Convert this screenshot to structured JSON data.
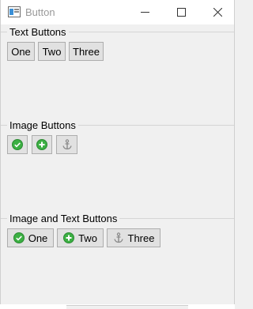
{
  "window": {
    "title": "Button"
  },
  "groups": {
    "text": {
      "label": "Text Buttons",
      "buttons": [
        "One",
        "Two",
        "Three"
      ]
    },
    "image": {
      "label": "Image Buttons",
      "icons": [
        "check-icon",
        "plus-icon",
        "anchor-icon"
      ]
    },
    "image_text": {
      "label": "Image and Text Buttons",
      "buttons": [
        "One",
        "Two",
        "Three"
      ],
      "icons": [
        "check-icon",
        "plus-icon",
        "anchor-icon"
      ]
    }
  },
  "colors": {
    "check": "#3cb043",
    "plus": "#3cb043",
    "anchor": "#8a8a8a"
  }
}
